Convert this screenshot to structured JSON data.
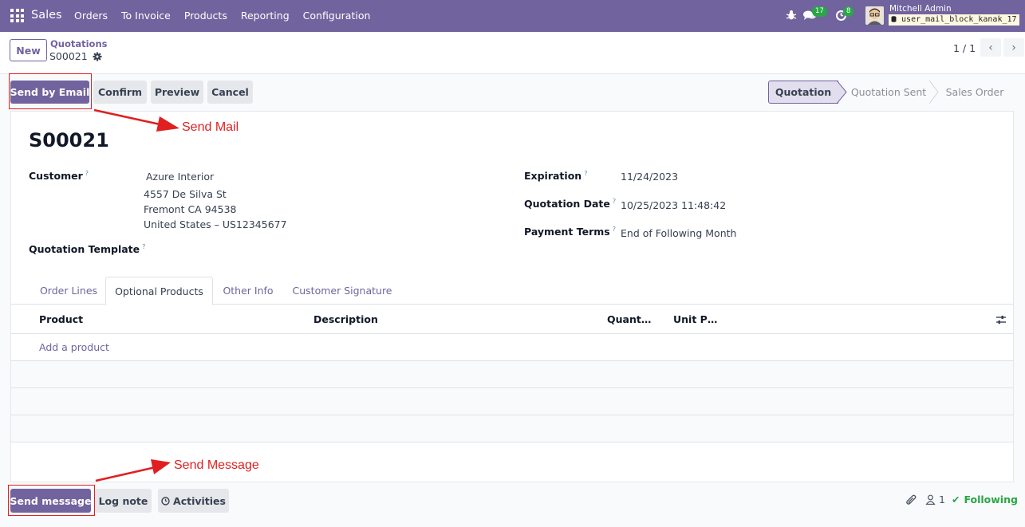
{
  "navbar": {
    "app_name": "Sales",
    "menu": [
      "Orders",
      "To Invoice",
      "Products",
      "Reporting",
      "Configuration"
    ],
    "messages_count": "17",
    "activities_count": "8",
    "user_name": "Mitchell Admin",
    "database": "user_mail_block_kanak_17",
    "color": "#71639e"
  },
  "control_panel": {
    "new_label": "New",
    "breadcrumb_parent": "Quotations",
    "breadcrumb_current": "S00021",
    "pager": "1 / 1"
  },
  "actions": {
    "send_by_email": "Send by Email",
    "confirm": "Confirm",
    "preview": "Preview",
    "cancel": "Cancel"
  },
  "stages": [
    "Quotation",
    "Quotation Sent",
    "Sales Order"
  ],
  "active_stage": "Quotation",
  "record": {
    "name": "S00021",
    "customer_label": "Customer",
    "customer_name": "Azure Interior",
    "address_line1": "4557 De Silva St",
    "address_line2": "Fremont CA 94538",
    "address_line3": "United States – US12345677",
    "template_label": "Quotation Template",
    "expiration_label": "Expiration",
    "expiration_value": "11/24/2023",
    "quotation_date_label": "Quotation Date",
    "quotation_date_value": "10/25/2023 11:48:42",
    "payment_terms_label": "Payment Terms",
    "payment_terms_value": "End of Following Month",
    "help_mark": "?"
  },
  "tabs": [
    "Order Lines",
    "Optional Products",
    "Other Info",
    "Customer Signature"
  ],
  "active_tab": "Optional Products",
  "table": {
    "columns": [
      "Product",
      "Description",
      "Quant…",
      "Unit P…"
    ],
    "add_line": "Add a product"
  },
  "chatter": {
    "send_message": "Send message",
    "log_note": "Log note",
    "activities": "Activities",
    "followers_count": "1",
    "following": "Following"
  },
  "annotations": {
    "send_mail": "Send Mail",
    "send_message": "Send Message",
    "color": "#e02020"
  }
}
